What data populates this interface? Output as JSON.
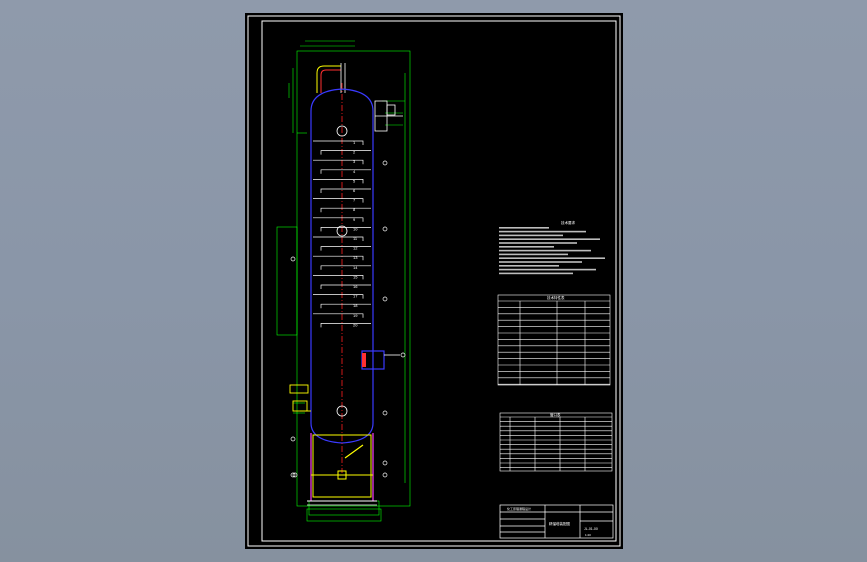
{
  "drawing": {
    "tray_numbers": [
      "1",
      "2",
      "3",
      "4",
      "5",
      "6",
      "7",
      "8",
      "9",
      "10",
      "11",
      "12",
      "13",
      "14",
      "15",
      "16",
      "17",
      "18",
      "19",
      "20"
    ],
    "notes_title": "技术要求",
    "spec_title": "技术特性表",
    "nozzle_title": "管口表",
    "title_block": {
      "company": "化工原理课程设计",
      "drawing_name": "精馏塔装配图",
      "drawing_no": "JL-01-00",
      "scale": "1:20"
    }
  },
  "colors": {
    "background": "#000000",
    "frame": "#ffffff",
    "shell": "#3a3aff",
    "trays": "#ffffff",
    "dimensions": "#00ff00",
    "center_line": "#ff2020",
    "nozzle_accent": "#ff4040",
    "skirt": "#ff40ff",
    "support": "#ffff00"
  }
}
